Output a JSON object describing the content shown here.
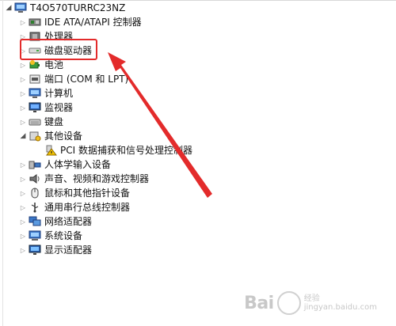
{
  "device_manager": {
    "root": {
      "label": "T4O570TURRC23NZ",
      "icon": "computer-icon"
    },
    "items": [
      {
        "label": "IDE ATA/ATAPI 控制器",
        "icon": "ide-controller-icon",
        "expanded": false
      },
      {
        "label": "处理器",
        "icon": "processor-icon",
        "expanded": false
      },
      {
        "label": "磁盘驱动器",
        "icon": "disk-drive-icon",
        "expanded": false
      },
      {
        "label": "电池",
        "icon": "battery-icon",
        "expanded": false
      },
      {
        "label": "端口 (COM 和 LPT)",
        "icon": "port-icon",
        "expanded": false
      },
      {
        "label": "计算机",
        "icon": "computer-icon",
        "expanded": false
      },
      {
        "label": "监视器",
        "icon": "monitor-icon",
        "expanded": false
      },
      {
        "label": "键盘",
        "icon": "keyboard-icon",
        "expanded": false
      },
      {
        "label": "其他设备",
        "icon": "other-devices-icon",
        "expanded": true,
        "children": [
          {
            "label": "PCI 数据捕获和信号处理控制器",
            "icon": "warning-device-icon"
          }
        ]
      },
      {
        "label": "人体学输入设备",
        "icon": "hid-icon",
        "expanded": false
      },
      {
        "label": "声音、视频和游戏控制器",
        "icon": "sound-icon",
        "expanded": false
      },
      {
        "label": "鼠标和其他指针设备",
        "icon": "mouse-icon",
        "expanded": false
      },
      {
        "label": "通用串行总线控制器",
        "icon": "usb-icon",
        "expanded": false
      },
      {
        "label": "网络适配器",
        "icon": "network-adapter-icon",
        "expanded": false
      },
      {
        "label": "系统设备",
        "icon": "system-devices-icon",
        "expanded": false
      },
      {
        "label": "显示适配器",
        "icon": "display-adapter-icon",
        "expanded": false
      }
    ]
  },
  "annotation": {
    "highlight_color": "#e32b2b",
    "arrow_color": "#e32b2b"
  },
  "watermark": {
    "logo": "Bai",
    "logo_tail": "经验",
    "sub_text": "jingyan.baidu.com"
  }
}
